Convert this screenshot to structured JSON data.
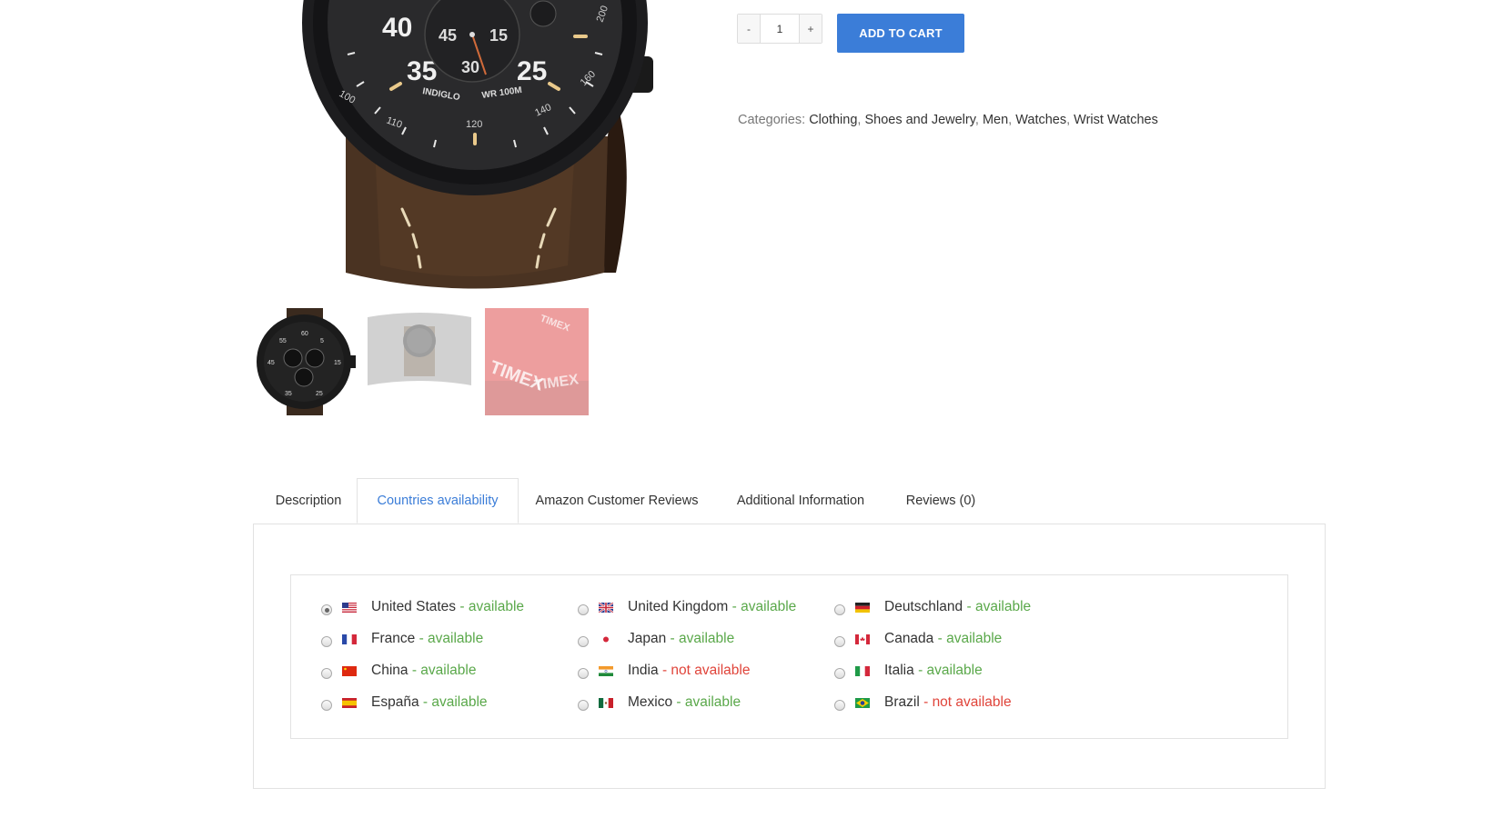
{
  "product": {
    "images": [
      {
        "name": "main-watch-image",
        "colors": {
          "case": "#1d1d1f",
          "dial": "#2a2a2c",
          "strap": "#4a3322",
          "stitch": "#e8d9b8",
          "accent": "#e9c98b"
        }
      },
      {
        "name": "thumbnail-watch-front"
      },
      {
        "name": "thumbnail-watch-side"
      },
      {
        "name": "thumbnail-watch-box",
        "label": "TIMEX"
      }
    ],
    "dial": {
      "numbers_large": [
        "40",
        "35",
        "25"
      ],
      "subdial": [
        "45",
        "15",
        "30"
      ],
      "bezel": [
        "100",
        "110",
        "120",
        "140",
        "160",
        "200"
      ],
      "texts": [
        "INDIGLO",
        "WR 100M"
      ]
    },
    "quantity": {
      "minus_label": "-",
      "value": "1",
      "plus_label": "+"
    },
    "add_to_cart_label": "ADD TO CART",
    "categories": {
      "label": "Categories:",
      "items": [
        "Clothing",
        "Shoes and Jewelry",
        "Men",
        "Watches",
        "Wrist Watches"
      ]
    }
  },
  "tabs": [
    {
      "label": "Description",
      "active": false
    },
    {
      "label": "Countries availability",
      "active": true
    },
    {
      "label": "Amazon Customer Reviews",
      "active": false
    },
    {
      "label": "Additional Information",
      "active": false
    },
    {
      "label": "Reviews (0)",
      "active": false
    }
  ],
  "countries": [
    {
      "name": "United States",
      "status": "available",
      "flag": "us-flag-icon",
      "selected": true
    },
    {
      "name": "United Kingdom",
      "status": "available",
      "flag": "uk-flag-icon"
    },
    {
      "name": "Deutschland",
      "status": "available",
      "flag": "de-flag-icon"
    },
    {
      "name": "France",
      "status": "available",
      "flag": "fr-flag-icon"
    },
    {
      "name": "Japan",
      "status": "available",
      "flag": "jp-flag-icon"
    },
    {
      "name": "Canada",
      "status": "available",
      "flag": "ca-flag-icon"
    },
    {
      "name": "China",
      "status": "available",
      "flag": "cn-flag-icon"
    },
    {
      "name": "India",
      "status": "not available",
      "flag": "in-flag-icon"
    },
    {
      "name": "Italia",
      "status": "available",
      "flag": "it-flag-icon"
    },
    {
      "name": "España",
      "status": "available",
      "flag": "es-flag-icon"
    },
    {
      "name": "Mexico",
      "status": "available",
      "flag": "mx-flag-icon"
    },
    {
      "name": "Brazil",
      "status": "not available",
      "flag": "br-flag-icon"
    }
  ],
  "colors": {
    "accent": "#3b7dd8",
    "available": "#5aa84a",
    "not_available": "#e0443a"
  }
}
